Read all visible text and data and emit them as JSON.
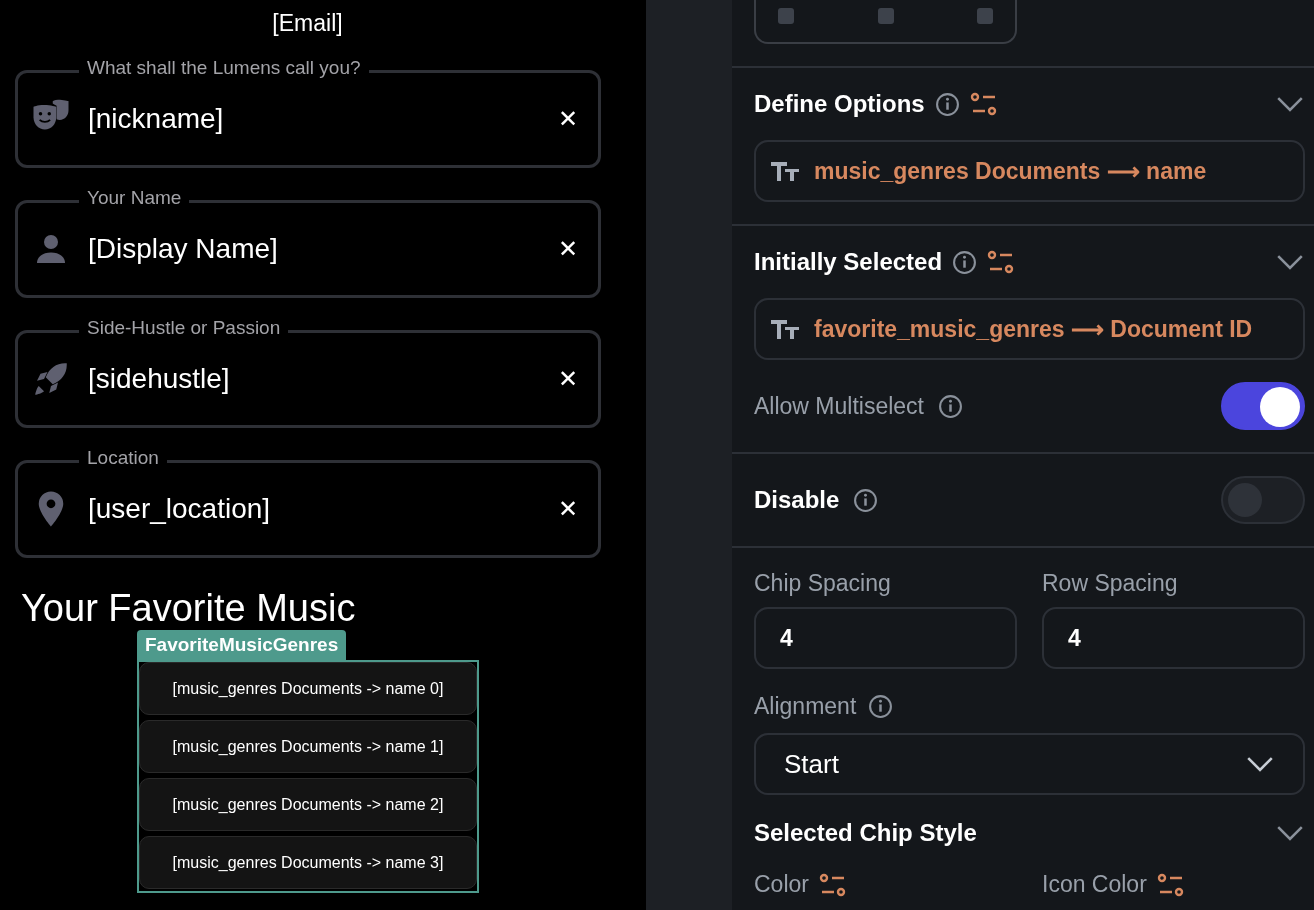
{
  "preview": {
    "email": "[Email]",
    "fields": [
      {
        "kind": "masks",
        "label": "What shall the Lumens call you?",
        "value": "[nickname]",
        "clear": "✕"
      },
      {
        "kind": "person",
        "label": "Your Name",
        "value": "[Display Name]",
        "clear": "✕"
      },
      {
        "kind": "rocket",
        "label": "Side-Hustle or Passion",
        "value": "[sidehustle]",
        "clear": "✕"
      },
      {
        "kind": "pin",
        "label": "Location",
        "value": "[user_location]",
        "clear": "✕"
      }
    ],
    "section_title": "Your Favorite Music",
    "widget": {
      "tag": "FavoriteMusicGenres",
      "chips": [
        "[music_genres Documents -> name 0]",
        "[music_genres Documents -> name 1]",
        "[music_genres Documents -> name 2]",
        "[music_genres Documents -> name 3]"
      ]
    }
  },
  "properties": {
    "define_options": {
      "title": "Define Options",
      "value": "music_genres Documents ⟶ name"
    },
    "initially_selected": {
      "title": "Initially Selected",
      "value": "favorite_music_genres ⟶ Document ID"
    },
    "allow_multiselect": {
      "label": "Allow Multiselect",
      "on": true
    },
    "disable": {
      "label": "Disable",
      "on": false
    },
    "chip_spacing": {
      "label": "Chip Spacing",
      "value": "4"
    },
    "row_spacing": {
      "label": "Row Spacing",
      "value": "4"
    },
    "alignment": {
      "label": "Alignment",
      "value": "Start"
    },
    "selected_chip_style": {
      "title": "Selected Chip Style",
      "color_label": "Color",
      "icon_color_label": "Icon Color"
    }
  }
}
